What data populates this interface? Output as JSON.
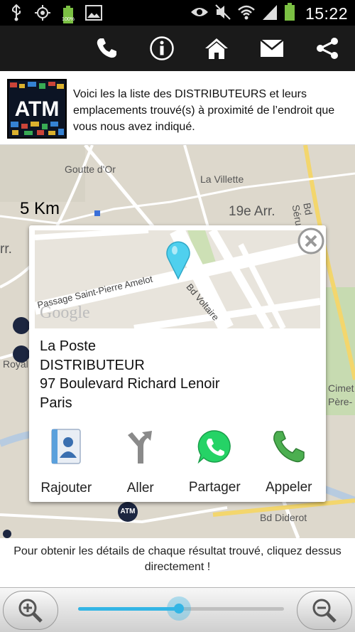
{
  "status_bar": {
    "time": "15:22",
    "battery_label": "100%",
    "icons": [
      "usb-icon",
      "gps-icon",
      "battery-icon",
      "image-icon",
      "eye-icon",
      "mute-icon",
      "wifi-icon",
      "signal-icon",
      "battery-icon"
    ]
  },
  "toolbar": {
    "icons": [
      "phone-icon",
      "info-icon",
      "home-icon",
      "mail-icon",
      "share-icon"
    ]
  },
  "header": {
    "logo_text": "ATM",
    "description": "Voici les la liste des DISTRIBUTEURS et leurs emplacements trouvé(s) à proximité de l’endroit que vous nous avez indiqué."
  },
  "map": {
    "scale_label": "5 Km",
    "labels": {
      "goutte_dor": "Goutte d'Or",
      "la_villette": "La Villette",
      "arr19": "19e Arr.",
      "arr_left": "rr.",
      "bd_serurier": "Bd Sérurier",
      "royal": "Royal",
      "cimet": "Cimet",
      "pere": "Père-",
      "bd_diderot": "Bd Diderot"
    }
  },
  "popup": {
    "mini_map": {
      "street1": "Passage Saint-Pierre Amelot",
      "street2": "Bd Voltaire",
      "brand": "Google"
    },
    "name": "La Poste",
    "type": "DISTRIBUTEUR",
    "address": "97 Boulevard Richard Lenoir",
    "city": "Paris",
    "actions": [
      {
        "label": "Rajouter",
        "icon": "contact-add-icon"
      },
      {
        "label": "Aller",
        "icon": "directions-icon"
      },
      {
        "label": "Partager",
        "icon": "whatsapp-icon"
      },
      {
        "label": "Appeler",
        "icon": "phone-call-icon"
      }
    ]
  },
  "footer": {
    "hint": "Pour obtenir les détails de chaque résultat trouvé, cliquez dessus directement !"
  },
  "zoom": {
    "level": 0.49
  },
  "colors": {
    "accent": "#33b5e5",
    "pin": "#4fd0ee",
    "battery": "#7bc043",
    "whatsapp": "#25d366",
    "call": "#4caf50"
  }
}
